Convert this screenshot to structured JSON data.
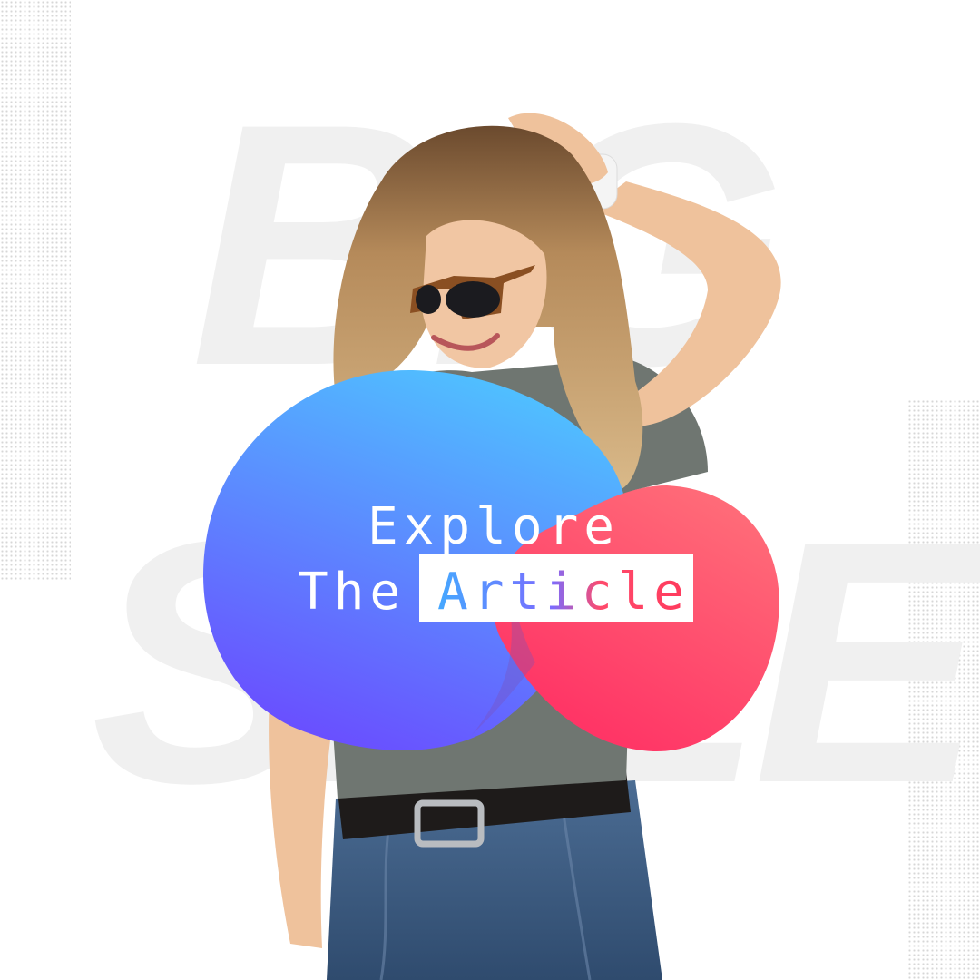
{
  "background": {
    "ghost_text_top": "BIG",
    "ghost_text_bottom": "SALE"
  },
  "headline": {
    "line1": "Explore",
    "line2_prefix": "The",
    "line2_highlight": "Article"
  },
  "colors": {
    "blue_blob_top": "#4fc3ff",
    "blue_blob_bottom": "#6a4dff",
    "red_blob_top": "#ff6e79",
    "red_blob_bottom": "#ff2d63",
    "shirt": "#6f7671",
    "jeans": "#3f5f86",
    "hair": "#b58a5a",
    "skin": "#f1c6a3"
  }
}
